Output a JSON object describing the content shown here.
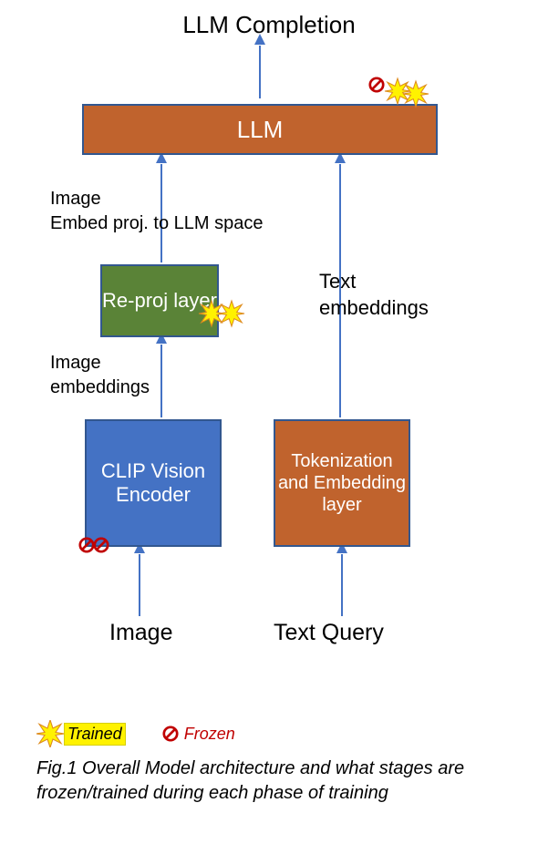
{
  "title": "LLM Completion",
  "boxes": {
    "llm": "LLM",
    "reproj": "Re-proj layer",
    "clip": "CLIP Vision Encoder",
    "tokemb": "Tokenization and Embedding layer"
  },
  "labels": {
    "img_embed_proj_line1": "Image",
    "img_embed_proj_line2": "Embed proj. to LLM space",
    "text_embeddings_line1": "Text",
    "text_embeddings_line2": "embeddings",
    "image_embeddings_line1": "Image",
    "image_embeddings_line2": "embeddings",
    "image_input": "Image",
    "text_query_input": "Text Query"
  },
  "legend": {
    "trained": "Trained",
    "frozen": "Frozen"
  },
  "caption": "Fig.1 Overall Model architecture and what stages are frozen/trained during each phase of training",
  "colors": {
    "llm_box": "#c0632d",
    "reproj_box": "#5a8337",
    "clip_box": "#4472c4",
    "tokemb_box": "#c0632d",
    "arrow": "#4472c4",
    "burst_fill": "#fff200",
    "burst_stroke": "#de8b1f",
    "prohibit": "#c00000",
    "highlight": "#fff200"
  },
  "diagram_data": {
    "type": "architecture",
    "nodes": [
      {
        "id": "image_input",
        "label": "Image",
        "kind": "input"
      },
      {
        "id": "text_query_input",
        "label": "Text Query",
        "kind": "input"
      },
      {
        "id": "clip",
        "label": "CLIP Vision Encoder",
        "status": [
          "frozen",
          "frozen"
        ]
      },
      {
        "id": "tokemb",
        "label": "Tokenization and Embedding layer"
      },
      {
        "id": "reproj",
        "label": "Re-proj layer",
        "status": [
          "trained",
          "trained"
        ]
      },
      {
        "id": "llm",
        "label": "LLM",
        "status": [
          "frozen",
          "trained"
        ]
      },
      {
        "id": "llm_completion",
        "label": "LLM Completion",
        "kind": "output"
      }
    ],
    "edges": [
      {
        "from": "image_input",
        "to": "clip"
      },
      {
        "from": "clip",
        "to": "reproj",
        "label": "Image embeddings"
      },
      {
        "from": "reproj",
        "to": "llm",
        "label": "Image Embed proj. to LLM space"
      },
      {
        "from": "text_query_input",
        "to": "tokemb"
      },
      {
        "from": "tokemb",
        "to": "llm",
        "label": "Text embeddings"
      },
      {
        "from": "llm",
        "to": "llm_completion"
      }
    ],
    "legend": [
      {
        "symbol": "burst",
        "meaning": "Trained"
      },
      {
        "symbol": "prohibit",
        "meaning": "Frozen"
      }
    ]
  }
}
